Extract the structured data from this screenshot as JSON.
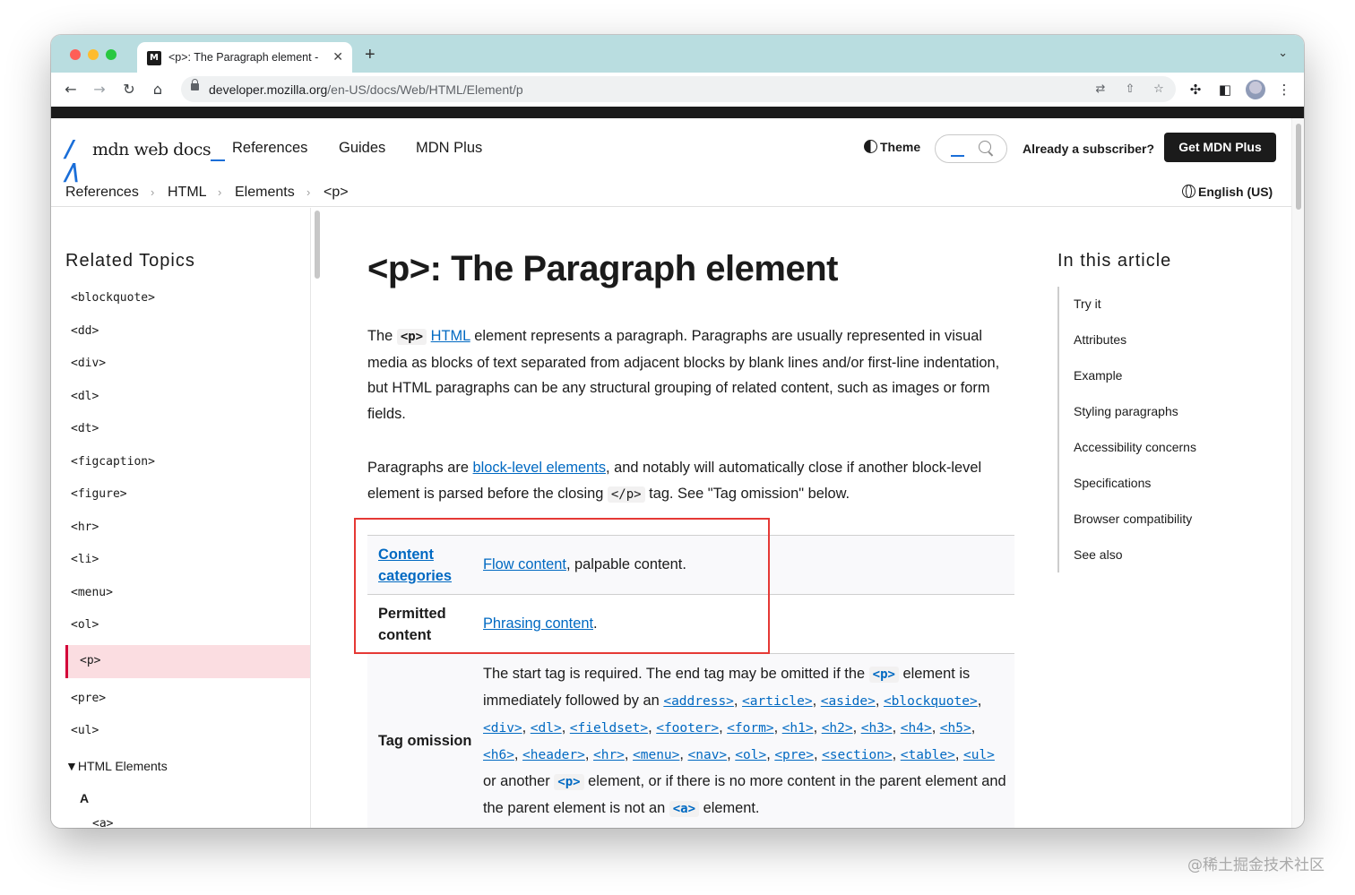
{
  "browser": {
    "tab_title": "<p>: The Paragraph element -",
    "tab_favicon": "M",
    "new_tab": "+",
    "url_domain": "developer.mozilla.org",
    "url_path": "/en-US/docs/Web/HTML/Element/p"
  },
  "header": {
    "logo_mark": "M",
    "logo_text": "mdn web docs",
    "nav": [
      "References",
      "Guides",
      "MDN Plus"
    ],
    "theme_label": "Theme",
    "subscriber_label": "Already a subscriber?",
    "cta_label": "Get MDN Plus"
  },
  "breadcrumbs": [
    "References",
    "HTML",
    "Elements",
    "<p>"
  ],
  "language": "English (US)",
  "sidebar": {
    "title": "Related Topics",
    "items": [
      "<blockquote>",
      "<dd>",
      "<div>",
      "<dl>",
      "<dt>",
      "<figcaption>",
      "<figure>",
      "<hr>",
      "<li>",
      "<menu>",
      "<ol>",
      "<p>",
      "<pre>",
      "<ul>"
    ],
    "active_item": "<p>",
    "group_label": "HTML Elements",
    "group_toggle": "▼",
    "letter": "A",
    "cut_item": "<a>"
  },
  "article": {
    "title": "<p>: The Paragraph element",
    "p1": {
      "before": "The ",
      "code": "<p>",
      "link": "HTML",
      "after": " element represents a paragraph. Paragraphs are usually represented in visual media as blocks of text separated from adjacent blocks by blank lines and/or first-line indentation, but HTML paragraphs can be any structural grouping of related content, such as images or form fields."
    },
    "p2": {
      "before": "Paragraphs are ",
      "link": "block-level elements",
      "middle": ", and notably will automatically close if another block-level element is parsed before the closing ",
      "code": "</p>",
      "after": " tag. See \"Tag omission\" below."
    },
    "table": {
      "row1_head": "Content categories",
      "row1_link": "Flow content",
      "row1_rest": ", palpable content.",
      "row2_head": "Permitted content",
      "row2_link": "Phrasing content",
      "row2_rest": ".",
      "row3_head": "Tag omission",
      "row3_intro": "The start tag is required. The end tag may be omitted if the ",
      "row3_code": "<p>",
      "row3_intro2": " element is immediately followed by an ",
      "row3_elements": [
        "<address>",
        "<article>",
        "<aside>",
        "<blockquote>",
        "<div>",
        "<dl>",
        "<fieldset>",
        "<footer>",
        "<form>",
        "<h1>",
        "<h2>",
        "<h3>",
        "<h4>",
        "<h5>",
        "<h6>",
        "<header>",
        "<hr>",
        "<menu>",
        "<nav>",
        "<ol>",
        "<pre>",
        "<section>",
        "<table>",
        "<ul>"
      ],
      "row3_or": " or another ",
      "row3_code2": "<p>",
      "row3_outro": " element, or if there is no more content in the parent element and the parent element is not an ",
      "row3_code3": "<a>",
      "row3_outro2": " element."
    }
  },
  "toc": {
    "title": "In this article",
    "items": [
      "Try it",
      "Attributes",
      "Example",
      "Styling paragraphs",
      "Accessibility concerns",
      "Specifications",
      "Browser compatibility",
      "See also"
    ]
  },
  "watermark": "@稀土掘金技术社区",
  "colors": {
    "link": "#0069c2",
    "active_bg": "#fbdde1",
    "active_border": "#d30038",
    "highlight": "#e53935",
    "tabstrip": "#b9dde0"
  }
}
